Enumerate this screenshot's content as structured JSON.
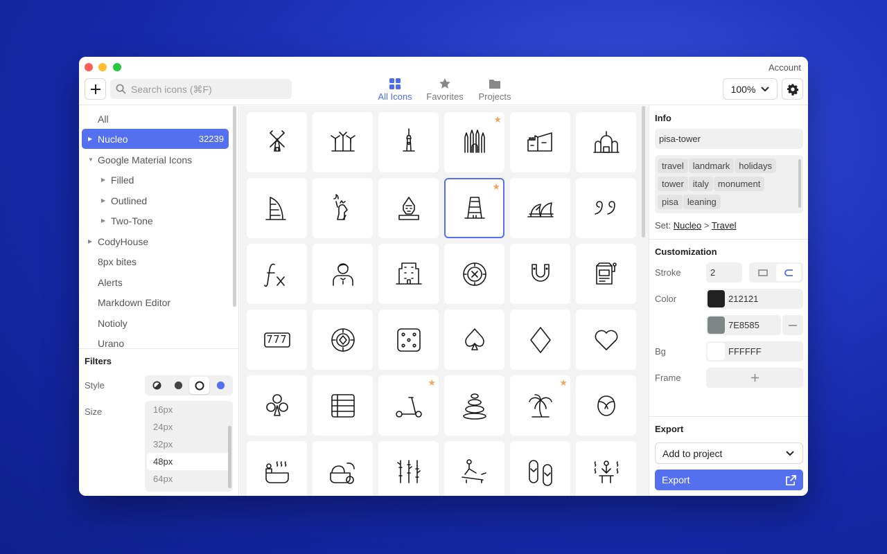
{
  "window": {
    "account": "Account"
  },
  "toolbar": {
    "search_placeholder": "Search icons (⌘F)",
    "zoom": "100%",
    "tabs": [
      {
        "label": "All Icons",
        "icon": "grid-icon",
        "active": true
      },
      {
        "label": "Favorites",
        "icon": "star-icon",
        "active": false
      },
      {
        "label": "Projects",
        "icon": "folder-icon",
        "active": false
      }
    ]
  },
  "sidebar": {
    "items": [
      {
        "label": "All"
      },
      {
        "label": "Nucleo",
        "count": "32239",
        "selected": true
      },
      {
        "label": "Google Material Icons"
      },
      {
        "label": "Filled"
      },
      {
        "label": "Outlined"
      },
      {
        "label": "Two-Tone"
      },
      {
        "label": "CodyHouse"
      },
      {
        "label": "8px bites"
      },
      {
        "label": "Alerts"
      },
      {
        "label": "Markdown Editor"
      },
      {
        "label": "Notioly"
      },
      {
        "label": "Urano"
      }
    ],
    "filters": {
      "title": "Filters",
      "style_label": "Style",
      "size_label": "Size",
      "sizes": [
        "16px",
        "24px",
        "32px",
        "48px",
        "64px"
      ],
      "selected_size": "48px"
    }
  },
  "grid": {
    "icons": [
      "windmill-icon",
      "wind-turbines-icon",
      "cn-tower-icon",
      "sagrada-familia-icon",
      "great-wall-icon",
      "st-basils-cathedral-icon",
      "burj-al-arab-icon",
      "statue-of-liberty-icon",
      "sphinx-icon",
      "pisa-tower-icon",
      "sydney-opera-house-icon",
      "quote-icon",
      "function-icon",
      "waiter-icon",
      "office-building-icon",
      "roulette-icon",
      "horseshoe-icon",
      "slot-machine-icon",
      "slot-777-icon",
      "casino-chip-icon",
      "dice-icon",
      "spade-icon",
      "diamond-icon",
      "heart-icon",
      "club-icon",
      "table-list-icon",
      "scooter-icon",
      "zen-stones-icon",
      "palm-tree-icon",
      "turban-icon",
      "hot-tub-icon",
      "spa-cream-icon",
      "bamboo-icon",
      "massage-icon",
      "flip-flops-icon",
      "sauna-icon"
    ],
    "favorites": [
      "sagrada-familia-icon",
      "pisa-tower-icon",
      "scooter-icon",
      "palm-tree-icon"
    ],
    "selected": "pisa-tower-icon",
    "slot_text": "777"
  },
  "info": {
    "title": "Info",
    "name": "pisa-tower",
    "tags": [
      "travel",
      "landmark",
      "holidays",
      "tower",
      "italy",
      "monument",
      "pisa",
      "leaning"
    ],
    "set_label": "Set:",
    "set_name": "Nucleo",
    "set_sep": ">",
    "category": "Travel"
  },
  "customization": {
    "title": "Customization",
    "stroke_label": "Stroke",
    "stroke_value": "2",
    "color_label": "Color",
    "color1": "212121",
    "color2": "7E8585",
    "bg_label": "Bg",
    "bg_value": "FFFFFF",
    "frame_label": "Frame",
    "swatch_colors": {
      "color1": "#212121",
      "color2": "#7E8585",
      "bg": "#FFFFFF"
    }
  },
  "export": {
    "title": "Export",
    "select_value": "Add to project",
    "button_label": "Export"
  },
  "theme": {
    "accent": "#5470EE",
    "favorite_star": "#F0A860"
  }
}
